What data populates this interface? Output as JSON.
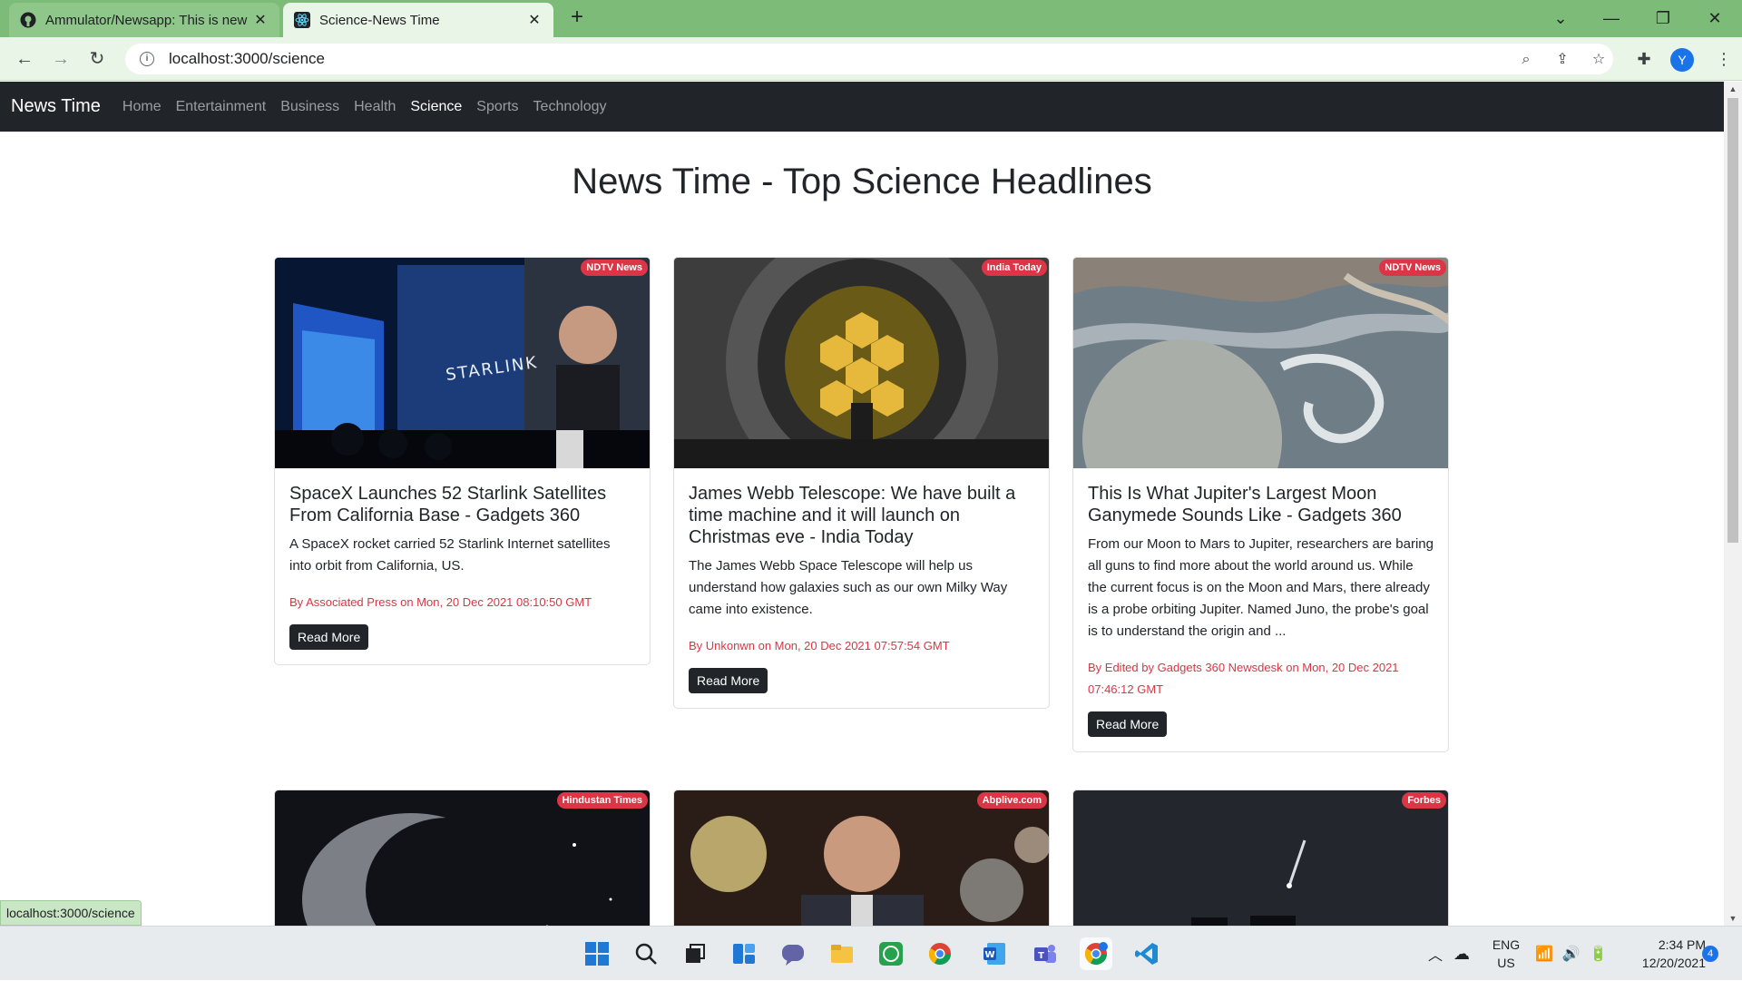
{
  "browser": {
    "tabs": [
      {
        "title": "Ammulator/Newsapp: This is new",
        "favicon": "github-icon",
        "active": false
      },
      {
        "title": "Science-News Time",
        "favicon": "react-icon",
        "active": true
      }
    ],
    "address": "localhost:3000/science",
    "avatar_letter": "Y",
    "status_url": "localhost:3000/science"
  },
  "navbar": {
    "brand": "News Time",
    "links": [
      "Home",
      "Entertainment",
      "Business",
      "Health",
      "Science",
      "Sports",
      "Technology"
    ],
    "active_link": "Science"
  },
  "heading": "News Time - Top Science Headlines",
  "articles": [
    {
      "source": "NDTV News",
      "title": "SpaceX Launches 52 Starlink Satellites From California Base - Gadgets 360",
      "description": "A SpaceX rocket carried 52 Starlink Internet satellites into orbit from California, US.",
      "meta": "By Associated Press on Mon, 20 Dec 2021 08:10:50 GMT",
      "image_text": "STARLINK",
      "button": "Read More"
    },
    {
      "source": "India Today",
      "title": "James Webb Telescope: We have built a time machine and it will launch on Christmas eve - India Today",
      "description": "The James Webb Space Telescope will help us understand how galaxies such as our own Milky Way came into existence.",
      "meta": "By Unkonwn on Mon, 20 Dec 2021 07:57:54 GMT",
      "button": "Read More"
    },
    {
      "source": "NDTV News",
      "title": "This Is What Jupiter's Largest Moon Ganymede Sounds Like - Gadgets 360",
      "description": "From our Moon to Mars to Jupiter, researchers are baring all guns to find more about the world around us. While the current focus is on the Moon and Mars, there already is a probe orbiting Jupiter. Named Juno, the probe's goal is to understand the origin and ...",
      "meta": "By Edited by Gadgets 360 Newsdesk on Mon, 20 Dec 2021 07:46:12 GMT",
      "button": "Read More"
    },
    {
      "source": "Hindustan Times"
    },
    {
      "source": "Abplive.com"
    },
    {
      "source": "Forbes"
    }
  ],
  "taskbar": {
    "apps": [
      "windows-start-icon",
      "search-icon",
      "task-view-icon",
      "widgets-icon",
      "chat-icon",
      "file-explorer-icon",
      "whatsapp-icon",
      "chrome-icon",
      "word-icon",
      "teams-icon",
      "chrome-profile-icon",
      "vscode-icon"
    ],
    "lang_top": "ENG",
    "lang_bottom": "US",
    "time": "2:34 PM",
    "date": "12/20/2021",
    "notifications": "4"
  }
}
